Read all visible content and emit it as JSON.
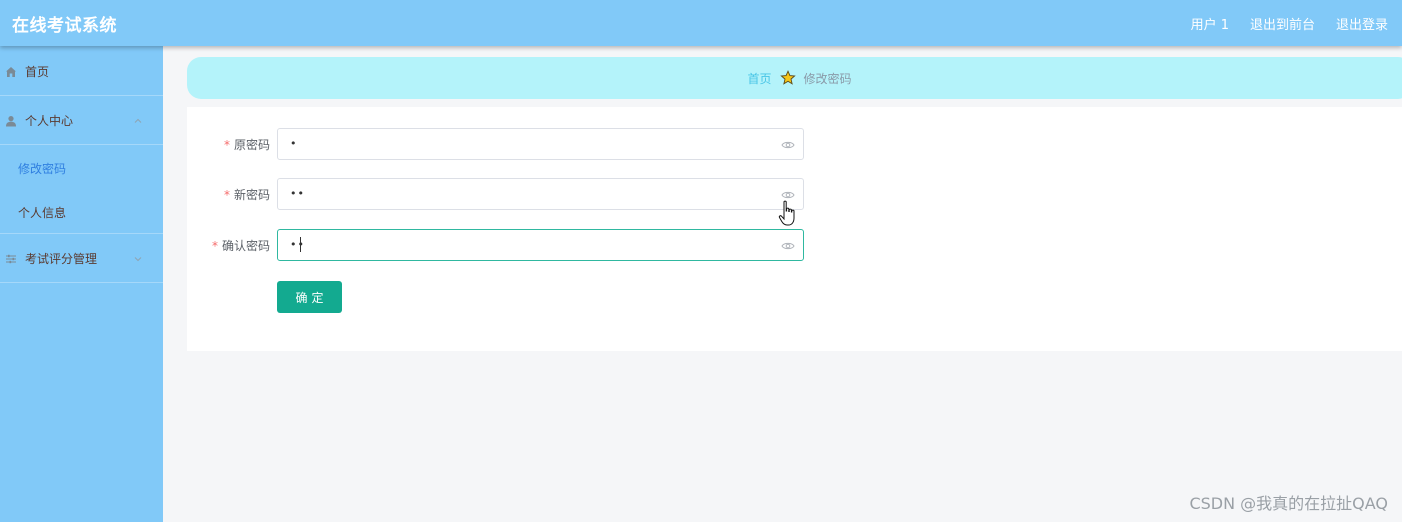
{
  "header": {
    "app_title": "在线考试系统",
    "user_label": "用户 1",
    "exit_front_label": "退出到前台",
    "logout_label": "退出登录"
  },
  "sidebar": {
    "items": [
      {
        "label": "首页",
        "icon": "home-icon"
      },
      {
        "label": "个人中心",
        "icon": "user-icon",
        "expanded": true,
        "children": [
          {
            "label": "修改密码",
            "active": true
          },
          {
            "label": "个人信息",
            "active": false
          }
        ]
      },
      {
        "label": "考试评分管理",
        "icon": "sliders-icon",
        "expanded": false
      }
    ]
  },
  "breadcrumb": {
    "home": "首页",
    "separator_icon": "star-icon",
    "current": "修改密码"
  },
  "form": {
    "fields": [
      {
        "label": "原密码",
        "required": true,
        "masked_value": "•"
      },
      {
        "label": "新密码",
        "required": true,
        "masked_value": "••"
      },
      {
        "label": "确认密码",
        "required": true,
        "masked_value": "••",
        "focused": true
      }
    ],
    "submit_label": "确定"
  },
  "watermark": "CSDN @我真的在拉扯QAQ",
  "colors": {
    "header_bg": "#81c9f8",
    "sidebar_bg": "#81c9f8",
    "breadcrumb_bg": "#b4f3fa",
    "primary_button": "#13aa90",
    "active_menu_text": "#2f7fe0",
    "required_asterisk": "#f56c6c"
  }
}
